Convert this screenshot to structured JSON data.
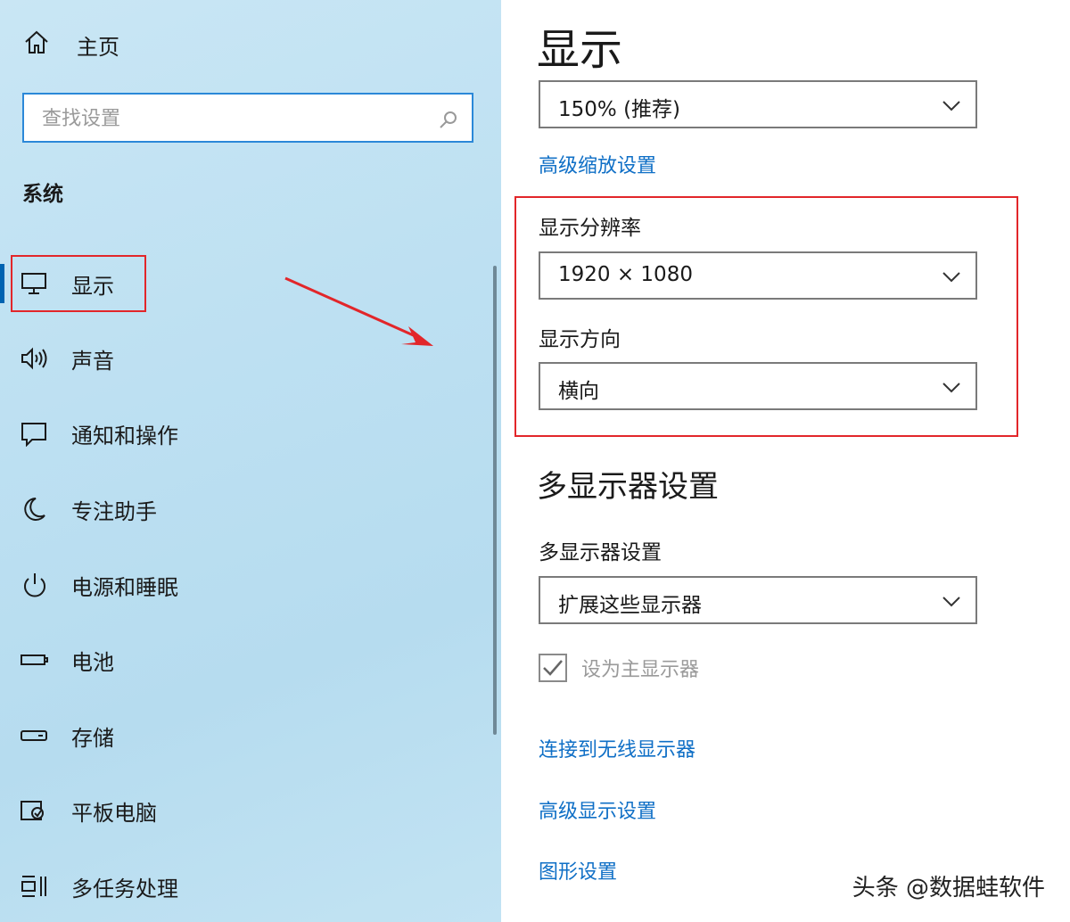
{
  "sidebar": {
    "home_label": "主页",
    "search_placeholder": "查找设置",
    "section_title": "系统",
    "items": [
      {
        "label": "显示",
        "icon": "monitor-icon"
      },
      {
        "label": "声音",
        "icon": "speaker-icon"
      },
      {
        "label": "通知和操作",
        "icon": "notification-icon"
      },
      {
        "label": "专注助手",
        "icon": "moon-icon"
      },
      {
        "label": "电源和睡眠",
        "icon": "power-icon"
      },
      {
        "label": "电池",
        "icon": "battery-icon"
      },
      {
        "label": "存储",
        "icon": "storage-icon"
      },
      {
        "label": "平板电脑",
        "icon": "tablet-icon"
      },
      {
        "label": "多任务处理",
        "icon": "multitask-icon"
      }
    ]
  },
  "main": {
    "title": "显示",
    "scale_value": "150% (推荐)",
    "advanced_scaling_link": "高级缩放设置",
    "resolution_label": "显示分辨率",
    "resolution_value": "1920 × 1080",
    "orientation_label": "显示方向",
    "orientation_value": "横向",
    "multi_display_title": "多显示器设置",
    "multi_display_label": "多显示器设置",
    "multi_display_value": "扩展这些显示器",
    "make_main_label": "设为主显示器",
    "make_main_checked": true,
    "wireless_link": "连接到无线显示器",
    "advanced_display_link": "高级显示设置",
    "graphics_link": "图形设置"
  },
  "watermark": "头条 @数据蛙软件",
  "colors": {
    "accent": "#0063b1",
    "link": "#0f6fc6",
    "highlight": "#e2262a",
    "sidebar_bg": "#c2e3f3"
  }
}
